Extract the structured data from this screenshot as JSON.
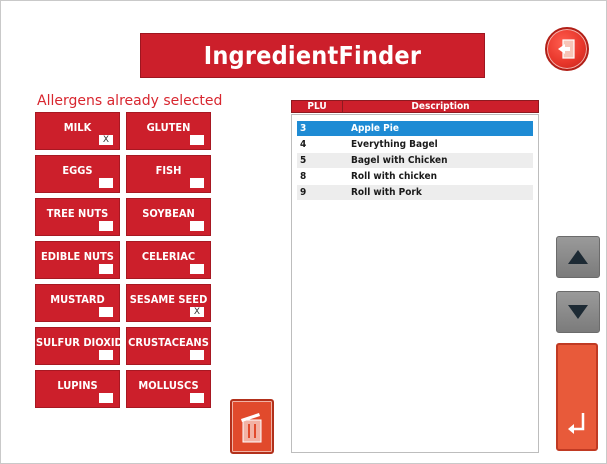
{
  "header": {
    "title": "IngredientFinder"
  },
  "allergens": {
    "heading": "Allergens already selected",
    "items": [
      {
        "label": "MILK",
        "mark": "X"
      },
      {
        "label": "GLUTEN",
        "mark": ""
      },
      {
        "label": "EGGS",
        "mark": ""
      },
      {
        "label": "FISH",
        "mark": ""
      },
      {
        "label": "TREE NUTS",
        "mark": ""
      },
      {
        "label": "SOYBEAN",
        "mark": ""
      },
      {
        "label": "EDIBLE NUTS",
        "mark": ""
      },
      {
        "label": "CELERIAC",
        "mark": ""
      },
      {
        "label": "MUSTARD",
        "mark": ""
      },
      {
        "label": "SESAME SEED",
        "mark": "X"
      },
      {
        "label": "SULFUR DIOXIDE",
        "mark": ""
      },
      {
        "label": "CRUSTACEANS",
        "mark": ""
      },
      {
        "label": "LUPINS",
        "mark": ""
      },
      {
        "label": "MOLLUSCS",
        "mark": ""
      }
    ]
  },
  "table": {
    "columns": [
      "PLU",
      "Description"
    ],
    "rows": [
      {
        "plu": "3",
        "description": "Apple Pie",
        "selected": true
      },
      {
        "plu": "4",
        "description": "Everything Bagel",
        "selected": false
      },
      {
        "plu": "5",
        "description": "Bagel with Chicken",
        "selected": false
      },
      {
        "plu": "8",
        "description": "Roll with chicken",
        "selected": false
      },
      {
        "plu": "9",
        "description": "Roll with Pork",
        "selected": false
      }
    ]
  },
  "icons": {
    "exit": "exit-door-icon",
    "trash": "trash-icon",
    "up": "arrow-up-icon",
    "down": "arrow-down-icon",
    "enter": "enter-return-icon"
  },
  "colors": {
    "accent": "#cc1f2b",
    "selected_row": "#1e8bd4",
    "action": "#e14a2c"
  }
}
